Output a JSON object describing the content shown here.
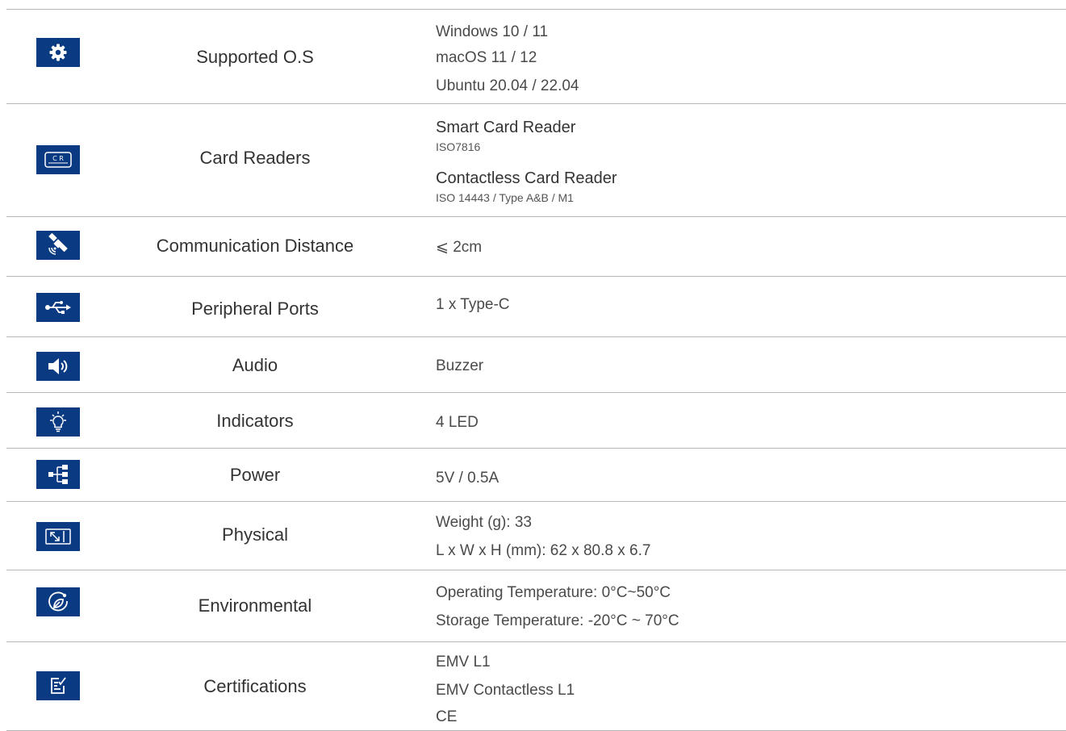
{
  "specs": [
    {
      "label": "Supported O.S",
      "icon": "gear-icon",
      "values": [
        "Windows 10 / 11",
        "macOS 11 / 12",
        "Ubuntu 20.04 / 22.04"
      ]
    },
    {
      "label": "Card Readers",
      "icon": "card-reader-icon",
      "icon_text": "C R",
      "values": [
        "Smart Card Reader",
        "ISO7816",
        "Contactless Card Reader",
        "ISO 14443 / Type A&B / M1"
      ]
    },
    {
      "label": "Communication Distance",
      "icon": "satellite-icon",
      "values": [
        "⩽ 2cm"
      ]
    },
    {
      "label": "Peripheral Ports",
      "icon": "usb-icon",
      "values": [
        "1 x Type-C"
      ]
    },
    {
      "label": "Audio",
      "icon": "speaker-icon",
      "values": [
        "Buzzer"
      ]
    },
    {
      "label": "Indicators",
      "icon": "lightbulb-icon",
      "values": [
        "4 LED"
      ]
    },
    {
      "label": "Power",
      "icon": "network-tree-icon",
      "values": [
        "5V / 0.5A"
      ]
    },
    {
      "label": "Physical",
      "icon": "resize-icon",
      "values": [
        "Weight (g): 33",
        "L x W x H (mm): 62 x 80.8 x 6.7"
      ]
    },
    {
      "label": "Environmental",
      "icon": "leaf-circle-icon",
      "values": [
        "Operating Temperature: 0°C~50°C",
        "Storage Temperature: -20°C ~ 70°C"
      ]
    },
    {
      "label": "Certifications",
      "icon": "checklist-icon",
      "values": [
        "EMV L1",
        "EMV Contactless L1",
        "CE"
      ]
    }
  ],
  "colors": {
    "icon_bg": "#0a3a82",
    "divider": "#b9b9b9",
    "label_text": "#333333",
    "value_text": "#4a4a4a"
  }
}
